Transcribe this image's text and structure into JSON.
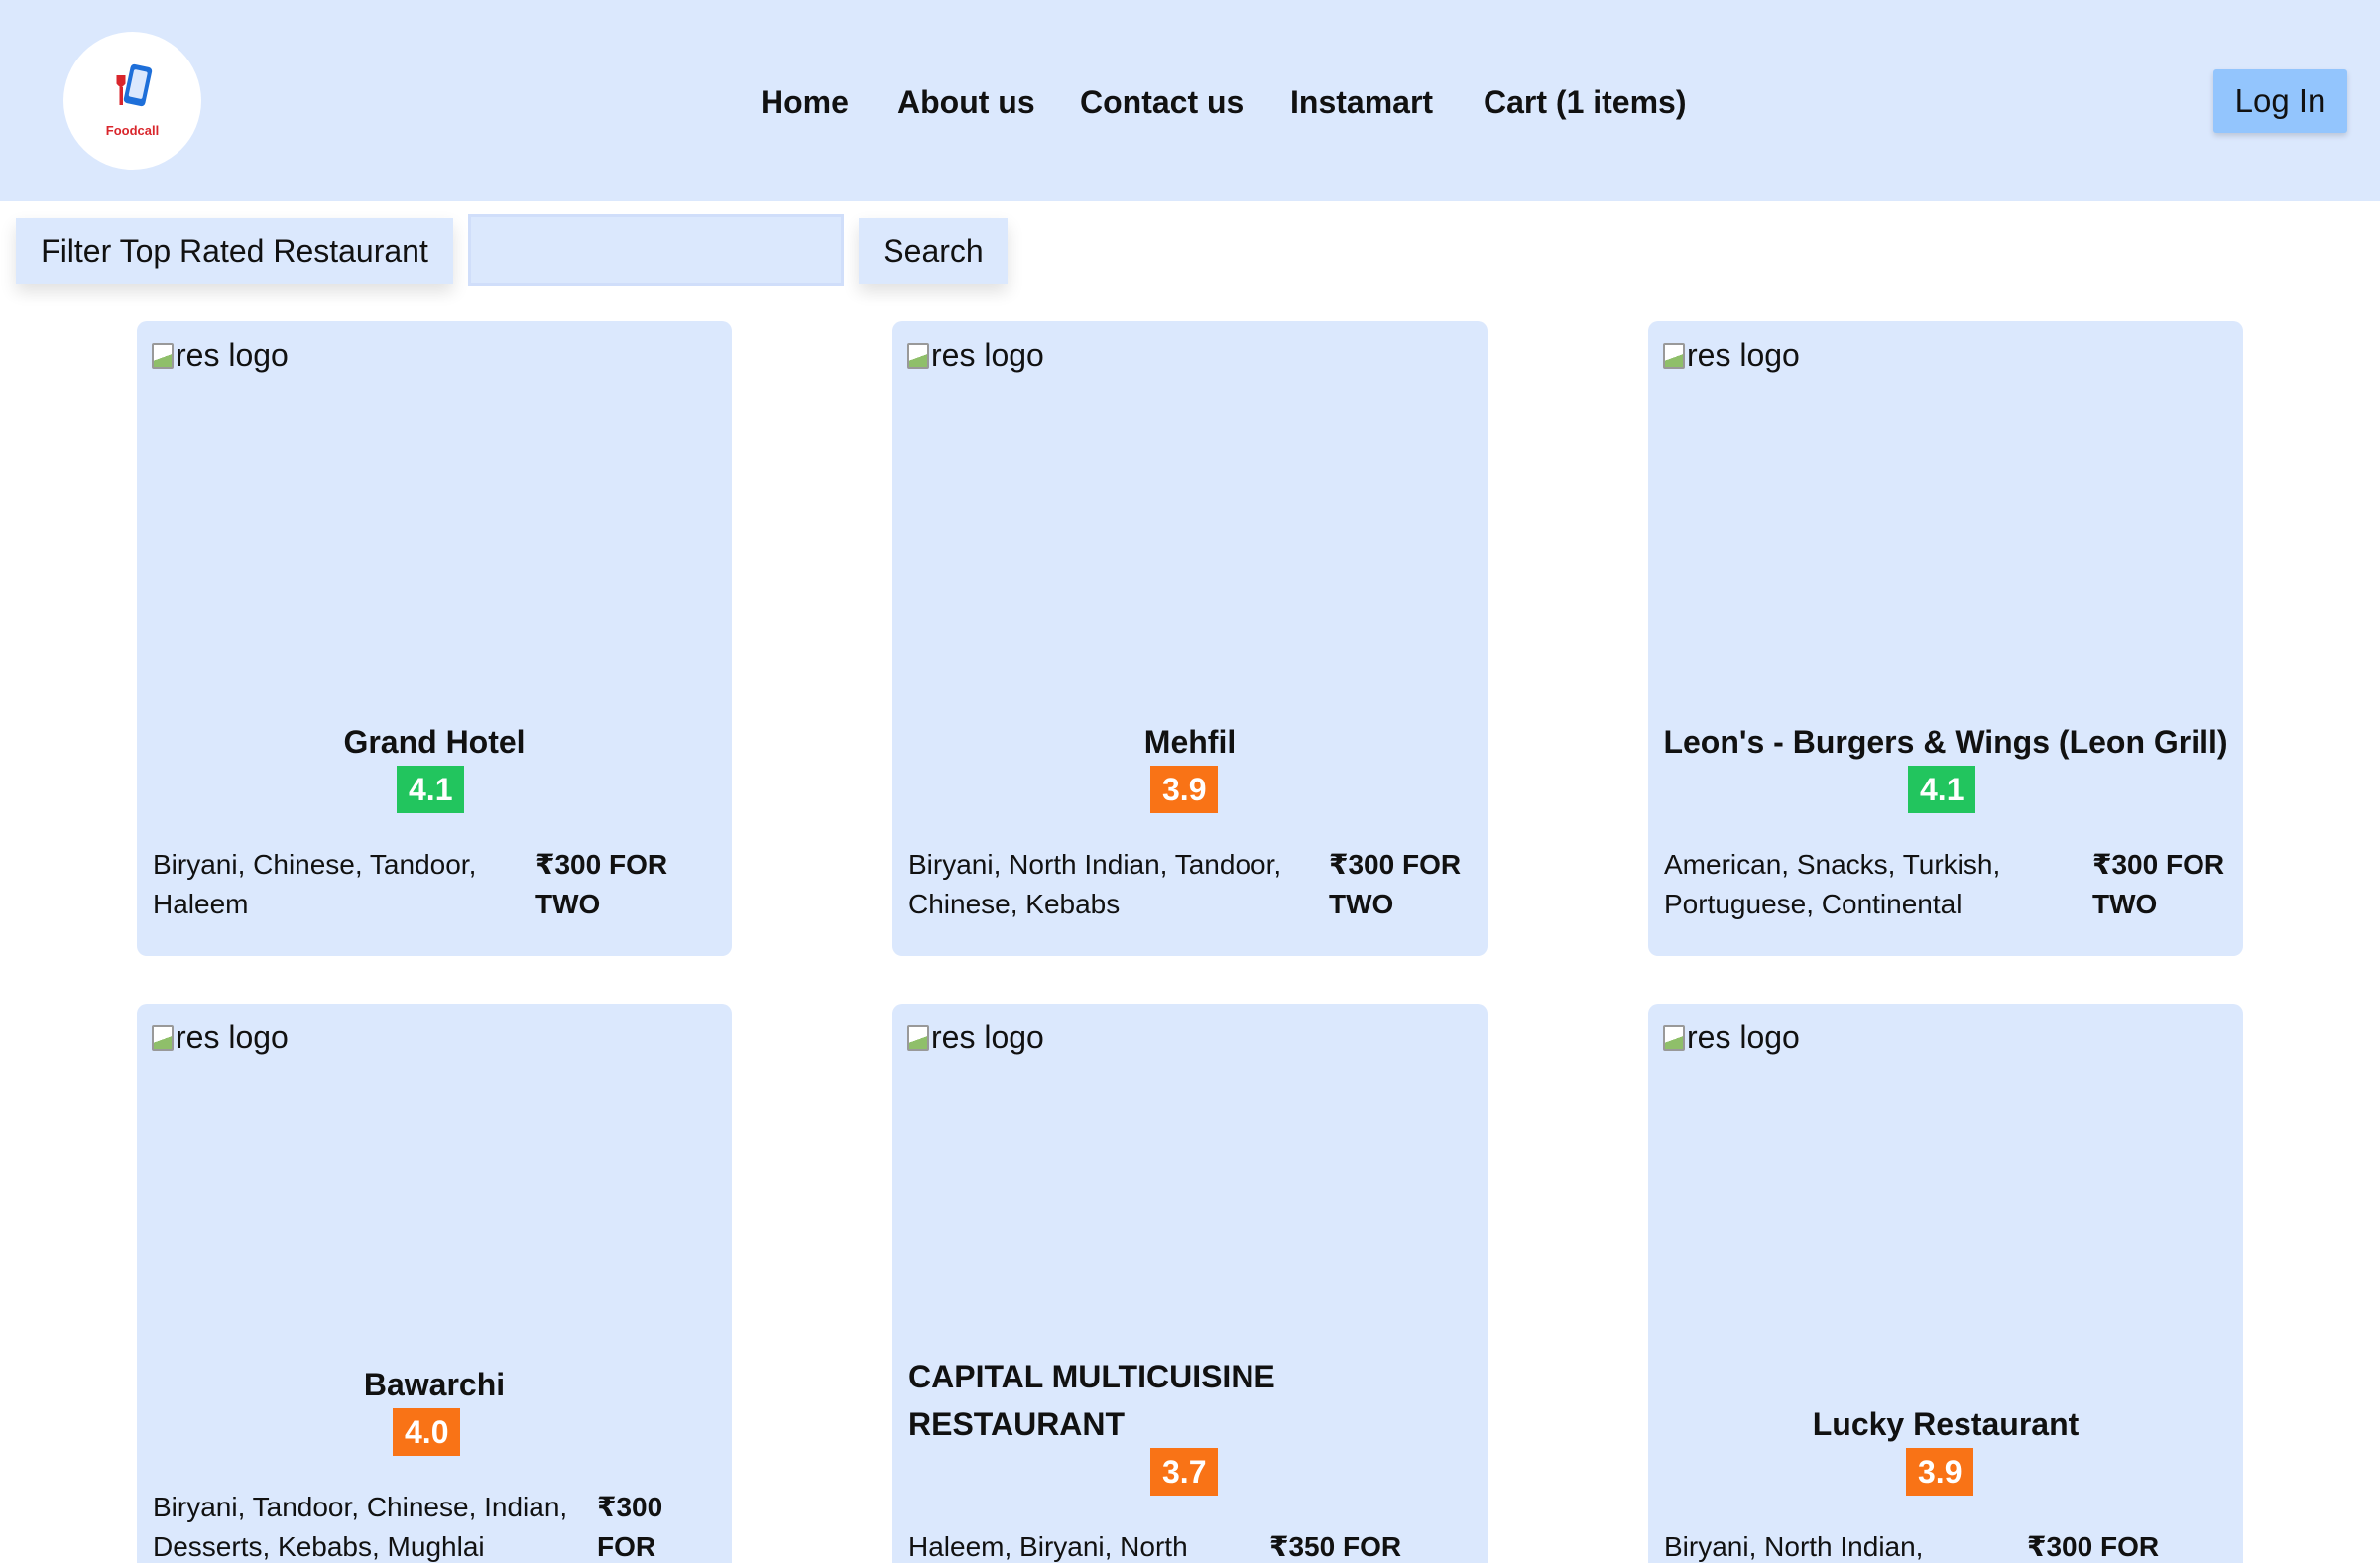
{
  "header": {
    "logo_text": "Foodcall",
    "nav": [
      "Home",
      "About us",
      "Contact us",
      "Instamart",
      "Cart (1 items)"
    ],
    "login_label": "Log In"
  },
  "filters": {
    "top_rated_label": "Filter Top Rated Restaurant",
    "search_value": "",
    "search_label": "Search"
  },
  "colors": {
    "header_bg": "#dbe8fd",
    "card_bg": "#dbe8fd",
    "rating_high": "#22c55e",
    "rating_low": "#f97316",
    "login_bg": "#93c5fd"
  },
  "restaurants": [
    {
      "img_alt": "res logo",
      "name": "Grand Hotel",
      "rating": "4.1",
      "rating_level": "green",
      "cuisines": "Biryani, Chinese, Tandoor, Haleem",
      "cost": "₹300 FOR TWO"
    },
    {
      "img_alt": "res logo",
      "name": "Mehfil",
      "rating": "3.9",
      "rating_level": "orange",
      "cuisines": "Biryani, North Indian, Tandoor, Chinese, Kebabs",
      "cost": "₹300 FOR TWO"
    },
    {
      "img_alt": "res logo",
      "name": "Leon's - Burgers & Wings (Leon Grill)",
      "rating": "4.1",
      "rating_level": "green",
      "cuisines": "American, Snacks, Turkish, Portuguese, Continental",
      "cost": "₹300 FOR TWO"
    },
    {
      "img_alt": "res logo",
      "name": "Bawarchi",
      "rating": "4.0",
      "rating_level": "orange",
      "cuisines": "Biryani, Tandoor, Chinese, Indian, Desserts, Kebabs, Mughlai",
      "cost": "₹300 FOR"
    },
    {
      "img_alt": "res logo",
      "name": "CAPITAL MULTICUISINE RESTAURANT",
      "rating": "3.7",
      "rating_level": "orange",
      "cuisines": "Haleem, Biryani, North",
      "cost": "₹350 FOR"
    },
    {
      "img_alt": "res logo",
      "name": "Lucky Restaurant",
      "rating": "3.9",
      "rating_level": "orange",
      "cuisines": "Biryani, North Indian,",
      "cost": "₹300 FOR"
    }
  ]
}
